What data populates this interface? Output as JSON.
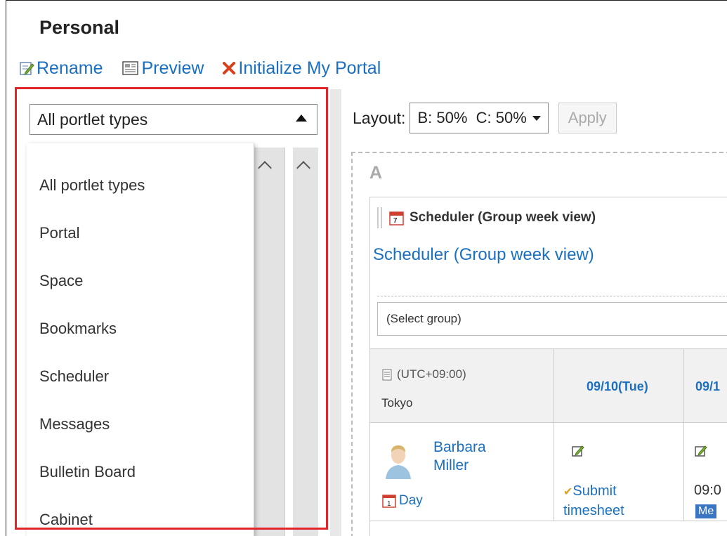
{
  "page": {
    "title": "Personal"
  },
  "toolbar": {
    "rename": "Rename",
    "preview": "Preview",
    "initialize": "Initialize My Portal"
  },
  "filter": {
    "selected": "All portlet types",
    "options": [
      "All portlet types",
      "Portal",
      "Space",
      "Bookmarks",
      "Scheduler",
      "Messages",
      "Bulletin Board",
      "Cabinet"
    ]
  },
  "layout": {
    "label": "Layout:",
    "value": "B: 50%  C: 50%",
    "apply": "Apply"
  },
  "zone": {
    "label": "A"
  },
  "portlet": {
    "header": "Scheduler (Group week view)",
    "link": "Scheduler (Group week view)",
    "group_select": "(Select group)",
    "timezone": "(UTC+09:00)",
    "city": "Tokyo",
    "dates": [
      "09/10(Tue)",
      "09/1"
    ],
    "user": {
      "first": "Barbara",
      "last": "Miller"
    },
    "day_link": "Day",
    "submit_line1": "Submit",
    "submit_line2": "timesheet",
    "time": "09:0",
    "badge": "Me"
  },
  "colors": {
    "link": "#1a6fc0",
    "highlight": "#e0242a"
  }
}
